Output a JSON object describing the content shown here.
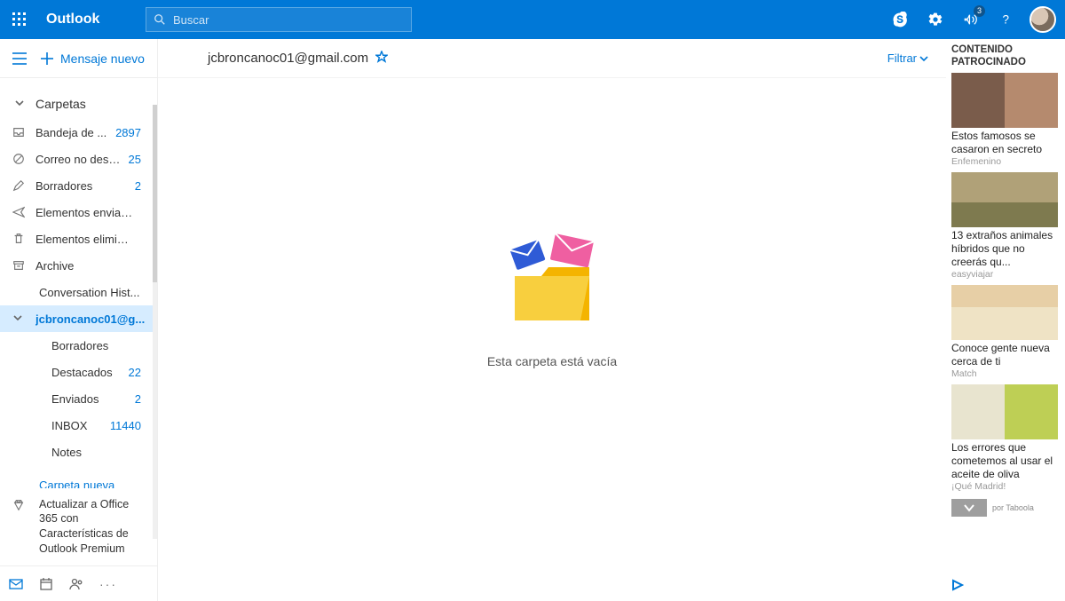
{
  "header": {
    "app_name": "Outlook",
    "search_placeholder": "Buscar",
    "notifications_count": "3"
  },
  "toolbar": {
    "new_message": "Mensaje nuevo"
  },
  "sidebar": {
    "folders_label": "Carpetas",
    "folders": [
      {
        "icon": "inbox-icon",
        "name": "Bandeja de ...",
        "count": "2897"
      },
      {
        "icon": "blocked-icon",
        "name": "Correo no dese...",
        "count": "25"
      },
      {
        "icon": "pencil-icon",
        "name": "Borradores",
        "count": "2"
      },
      {
        "icon": "send-icon",
        "name": "Elementos enviados",
        "count": ""
      },
      {
        "icon": "trash-icon",
        "name": "Elementos elimina...",
        "count": ""
      },
      {
        "icon": "archive-icon",
        "name": "Archive",
        "count": ""
      },
      {
        "icon": "",
        "name": "Conversation Hist...",
        "count": ""
      }
    ],
    "selected_account": "jcbroncanoc01@g...",
    "subfolders": [
      {
        "name": "Borradores",
        "count": ""
      },
      {
        "name": "Destacados",
        "count": "22"
      },
      {
        "name": "Enviados",
        "count": "2"
      },
      {
        "name": "INBOX",
        "count": "11440"
      },
      {
        "name": "Notes",
        "count": ""
      }
    ],
    "new_folder": "Carpeta nueva",
    "upgrade": "Actualizar a Office 365 con Características de Outlook Premium"
  },
  "content": {
    "title": "jcbroncanoc01@gmail.com",
    "filter_label": "Filtrar",
    "empty_text": "Esta carpeta está vacía"
  },
  "ads": {
    "heading": "CONTENIDO PATROCINADO",
    "items": [
      {
        "title": "Estos famosos se casaron en secreto",
        "source": "Enfemenino"
      },
      {
        "title": "13 extraños animales híbridos que no creerás qu...",
        "source": "easyviajar"
      },
      {
        "title": "Conoce gente nueva cerca de ti",
        "source": "Match"
      },
      {
        "title": "Los errores que cometemos al usar el aceite de oliva",
        "source": "¡Qué Madrid!"
      }
    ],
    "taboola": "por Taboola"
  }
}
